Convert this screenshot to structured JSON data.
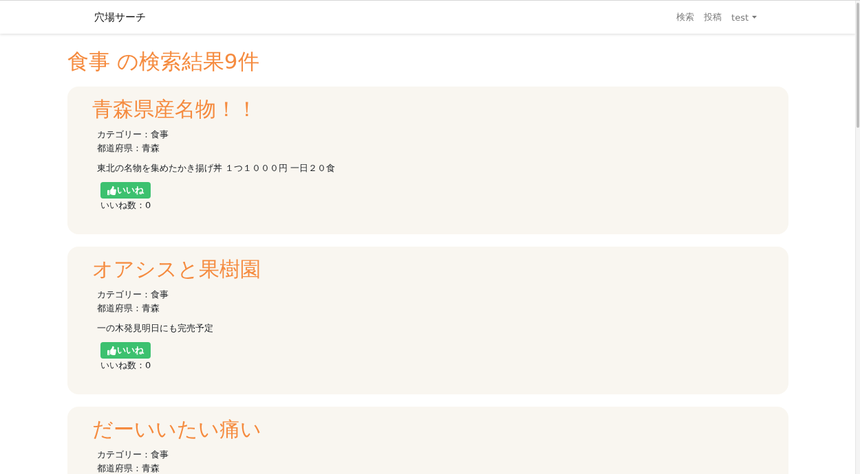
{
  "navbar": {
    "brand": "穴場サーチ",
    "links": [
      {
        "label": "検索"
      },
      {
        "label": "投稿"
      }
    ],
    "user_menu": {
      "label": "test"
    }
  },
  "heading": "食事 の検索結果9件",
  "results": [
    {
      "title": "青森県産名物！！",
      "category": "カテゴリー：食事",
      "prefecture": "都道府県：青森",
      "description": "東北の名物を集めたかき揚げ丼 １つ１０００円 一日２０食",
      "like_button": "いいね",
      "like_count": "いいね数：0"
    },
    {
      "title": "オアシスと果樹園",
      "category": "カテゴリー：食事",
      "prefecture": "都道府県：青森",
      "description": "一の木発見明日にも完売予定",
      "like_button": "いいね",
      "like_count": "いいね数：0"
    },
    {
      "title": "だーいいたい痛い",
      "category": "カテゴリー：食事",
      "prefecture": "都道府県：青森"
    }
  ]
}
